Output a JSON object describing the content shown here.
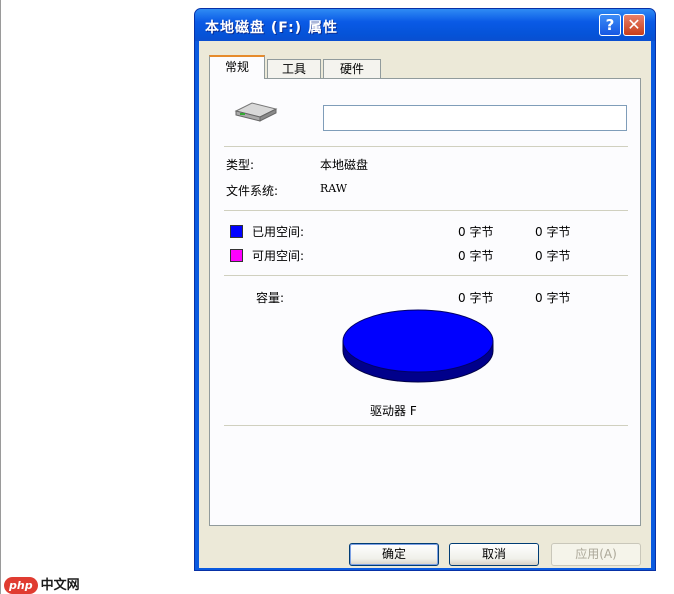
{
  "window": {
    "title": "本地磁盘 (F:) 属性",
    "help": "?",
    "close": "✕"
  },
  "tabs": [
    {
      "label": "常规"
    },
    {
      "label": "工具"
    },
    {
      "label": "硬件"
    }
  ],
  "general": {
    "volume_name": "",
    "type_label": "类型:",
    "type_value": "本地磁盘",
    "fs_label": "文件系统:",
    "fs_value": "RAW",
    "used_label": "已用空间:",
    "used_bytes": "0 字节",
    "used_size": "0 字节",
    "free_label": "可用空间:",
    "free_bytes": "0 字节",
    "free_size": "0 字节",
    "capacity_label": "容量:",
    "capacity_bytes": "0 字节",
    "capacity_size": "0 字节",
    "drive_label": "驱动器 F",
    "colors": {
      "used": "#0000ff",
      "free": "#ff00ff"
    }
  },
  "buttons": {
    "ok": "确定",
    "cancel": "取消",
    "apply": "应用(A)"
  },
  "watermark": {
    "badge": "php",
    "text": "中文网"
  }
}
